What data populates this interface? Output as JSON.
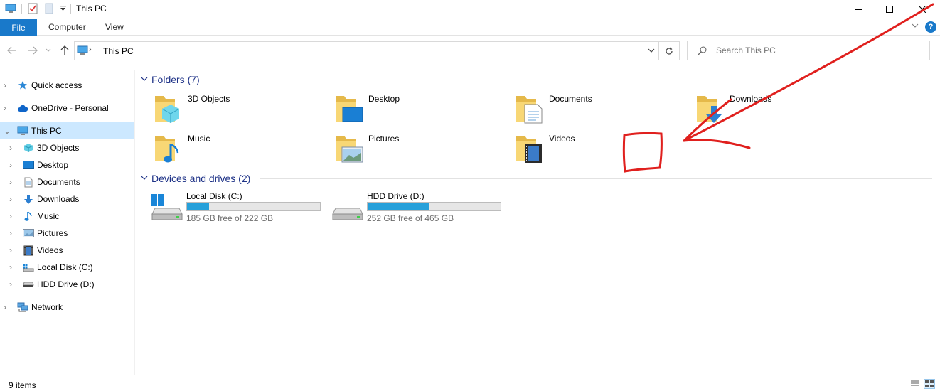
{
  "window": {
    "title": "This PC",
    "accent_color": "#1979ca",
    "selection_color": "#cce8ff"
  },
  "ribbon": {
    "tabs": [
      "File",
      "Computer",
      "View"
    ],
    "help": "?"
  },
  "address_bar": {
    "location": "This PC",
    "search_placeholder": "Search This PC"
  },
  "sidebar": {
    "items": [
      {
        "label": "Quick access",
        "icon": "star-icon",
        "selected": false
      },
      {
        "label": "OneDrive - Personal",
        "icon": "cloud-icon",
        "selected": false
      },
      {
        "label": "This PC",
        "icon": "computer-icon",
        "selected": true
      },
      {
        "label": "3D Objects",
        "icon": "cube-icon",
        "selected": false
      },
      {
        "label": "Desktop",
        "icon": "desktop-icon",
        "selected": false
      },
      {
        "label": "Documents",
        "icon": "document-icon",
        "selected": false
      },
      {
        "label": "Downloads",
        "icon": "download-icon",
        "selected": false
      },
      {
        "label": "Music",
        "icon": "music-note-icon",
        "selected": false
      },
      {
        "label": "Pictures",
        "icon": "picture-icon",
        "selected": false
      },
      {
        "label": "Videos",
        "icon": "film-icon",
        "selected": false
      },
      {
        "label": "Local Disk (C:)",
        "icon": "windows-drive-icon",
        "selected": false
      },
      {
        "label": "HDD Drive (D:)",
        "icon": "hard-drive-icon",
        "selected": false
      },
      {
        "label": "Network",
        "icon": "network-icon",
        "selected": false
      }
    ]
  },
  "folders_section": {
    "title": "Folders (7)",
    "items": [
      {
        "label": "3D Objects",
        "icon": "cube-icon"
      },
      {
        "label": "Desktop",
        "icon": "desktop-icon"
      },
      {
        "label": "Documents",
        "icon": "document-icon"
      },
      {
        "label": "Downloads",
        "icon": "download-icon"
      },
      {
        "label": "Music",
        "icon": "music-note-icon"
      },
      {
        "label": "Pictures",
        "icon": "picture-icon"
      },
      {
        "label": "Videos",
        "icon": "film-icon"
      }
    ]
  },
  "drives_section": {
    "title": "Devices and drives (2)",
    "items": [
      {
        "label": "Local Disk (C:)",
        "free_text": "185 GB free of 222 GB",
        "used_fraction": 0.167,
        "icon": "windows-drive-icon"
      },
      {
        "label": "HDD Drive (D:)",
        "free_text": "252 GB free of 465 GB",
        "used_fraction": 0.458,
        "icon": "hard-drive-icon"
      }
    ]
  },
  "status_bar": {
    "item_count": "9 items"
  },
  "annotation": {
    "color": "#e0201e"
  }
}
